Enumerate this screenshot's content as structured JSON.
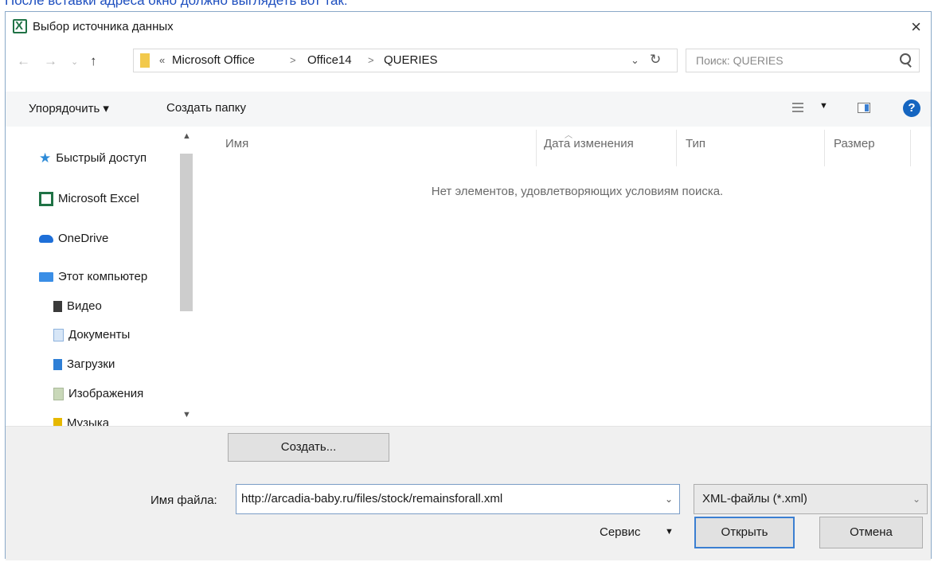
{
  "caption": "После вставки адреса окно должно выглядеть вот так:",
  "window": {
    "title": "Выбор источника данных",
    "close_glyph": "×"
  },
  "nav": {
    "breadcrumb": [
      "Microsoft Office",
      "Office14",
      "QUERIES"
    ],
    "overflow": "«",
    "search_placeholder": "Поиск: QUERIES"
  },
  "commands": {
    "organize": "Упорядочить ▾",
    "new_folder": "Создать папку",
    "help": "?"
  },
  "sidebar": {
    "items": [
      {
        "label": "Быстрый доступ",
        "icon": "star-icon"
      },
      {
        "label": "Microsoft Excel",
        "icon": "excel-icon"
      },
      {
        "label": "OneDrive",
        "icon": "cloud-icon"
      },
      {
        "label": "Этот компьютер",
        "icon": "computer-icon"
      },
      {
        "label": "Видео",
        "icon": "video-folder-icon"
      },
      {
        "label": "Документы",
        "icon": "documents-folder-icon"
      },
      {
        "label": "Загрузки",
        "icon": "downloads-folder-icon"
      },
      {
        "label": "Изображения",
        "icon": "pictures-folder-icon"
      },
      {
        "label": "Музыка",
        "icon": "music-folder-icon"
      }
    ]
  },
  "columns": {
    "name": "Имя",
    "date": "Дата изменения",
    "type": "Тип",
    "size": "Размер"
  },
  "empty_message": "Нет элементов, удовлетворяющих условиям поиска.",
  "footer": {
    "create_button": "Создать...",
    "filename_label": "Имя файла:",
    "filename_value": "http://arcadia-baby.ru/files/stock/remainsforall.xml",
    "filetype": "XML-файлы (*.xml)",
    "service": "Сервис",
    "open_button": "Открыть",
    "cancel_button": "Отмена"
  },
  "colors": {
    "accent": "#3b7fd1",
    "excel_green": "#1f7245",
    "caption_blue": "#1e4fbf"
  }
}
